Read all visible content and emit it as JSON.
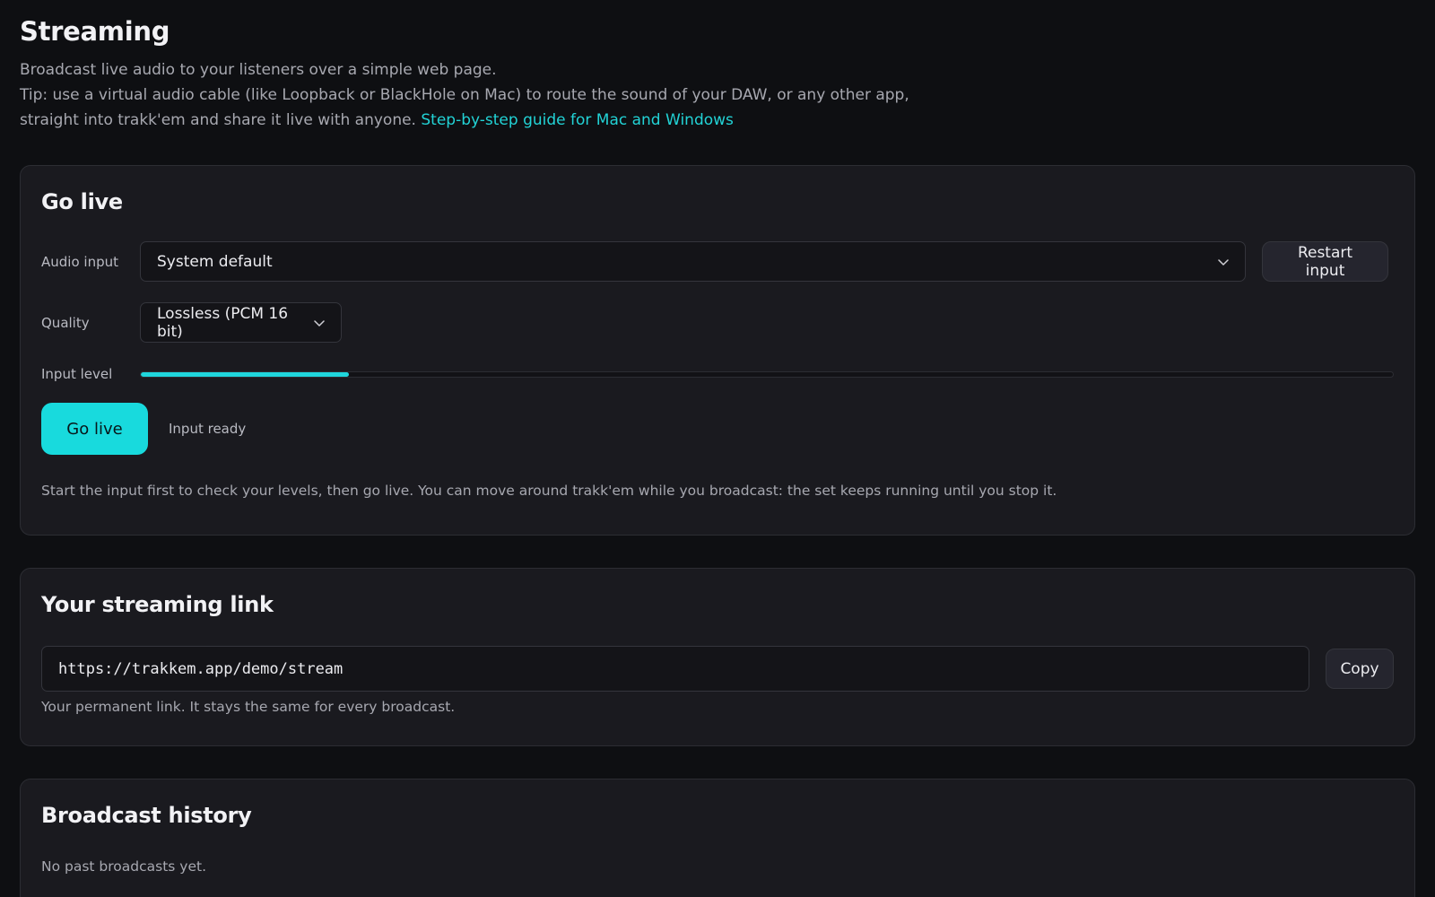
{
  "header": {
    "title": "Streaming",
    "intro_line1": "Broadcast live audio to your listeners over a simple web page.",
    "intro_line2": "Tip: use a virtual audio cable (like Loopback or BlackHole on Mac) to route the sound of your DAW, or any other app,",
    "intro_line3": "straight into trakk'em and share it live with anyone. ",
    "guide_link": "Step-by-step guide for Mac and Windows"
  },
  "go_live": {
    "title": "Go live",
    "audio_input_label": "Audio input",
    "audio_input_value": "System default",
    "restart_button": "Restart input",
    "quality_label": "Quality",
    "quality_value": "Lossless (PCM 16 bit)",
    "input_level_label": "Input level",
    "input_level_fraction": 0.166,
    "go_live_button": "Go live",
    "status": "Input ready",
    "help": "Start the input first to check your levels, then go live. You can move around trakk'em while you broadcast: the set keeps running until you stop it."
  },
  "streaming_link": {
    "title": "Your streaming link",
    "url": "https://trakkem.app/demo/stream",
    "copy_button": "Copy",
    "help": "Your permanent link. It stays the same for every broadcast."
  },
  "history": {
    "title": "Broadcast history",
    "empty": "No past broadcasts yet."
  },
  "colors": {
    "accent": "#18dadd",
    "background": "#0e0f12",
    "card": "#1a1a1f"
  },
  "icons": {
    "dropdown": "chevron-down-icon"
  }
}
